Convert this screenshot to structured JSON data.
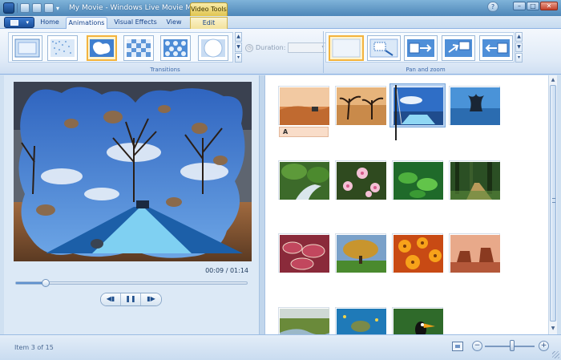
{
  "window": {
    "title": "My Movie - Windows Live Movie Maker",
    "context_tab_label": "Video Tools"
  },
  "tabs": [
    {
      "label": "Home"
    },
    {
      "label": "Animations"
    },
    {
      "label": "Visual Effects"
    },
    {
      "label": "View"
    },
    {
      "label": "Edit"
    }
  ],
  "ribbon": {
    "transitions_label": "Transitions",
    "pan_zoom_label": "Pan and zoom",
    "duration_label": "Duration:",
    "duration_value": ""
  },
  "preview": {
    "time_current": "00:09",
    "time_separator": " / ",
    "time_total": "01:14",
    "progress_fraction": 0.13
  },
  "storyboard": {
    "caption_icon": "A",
    "selected_index": 3
  },
  "status": {
    "item_text": "Item 3 of 15",
    "zoom_level_fraction": 0.55
  },
  "colors": {
    "accent": "#f3b33d",
    "context_tab": "#f2e29c",
    "ribbon_bg": "#dfeaf7"
  }
}
